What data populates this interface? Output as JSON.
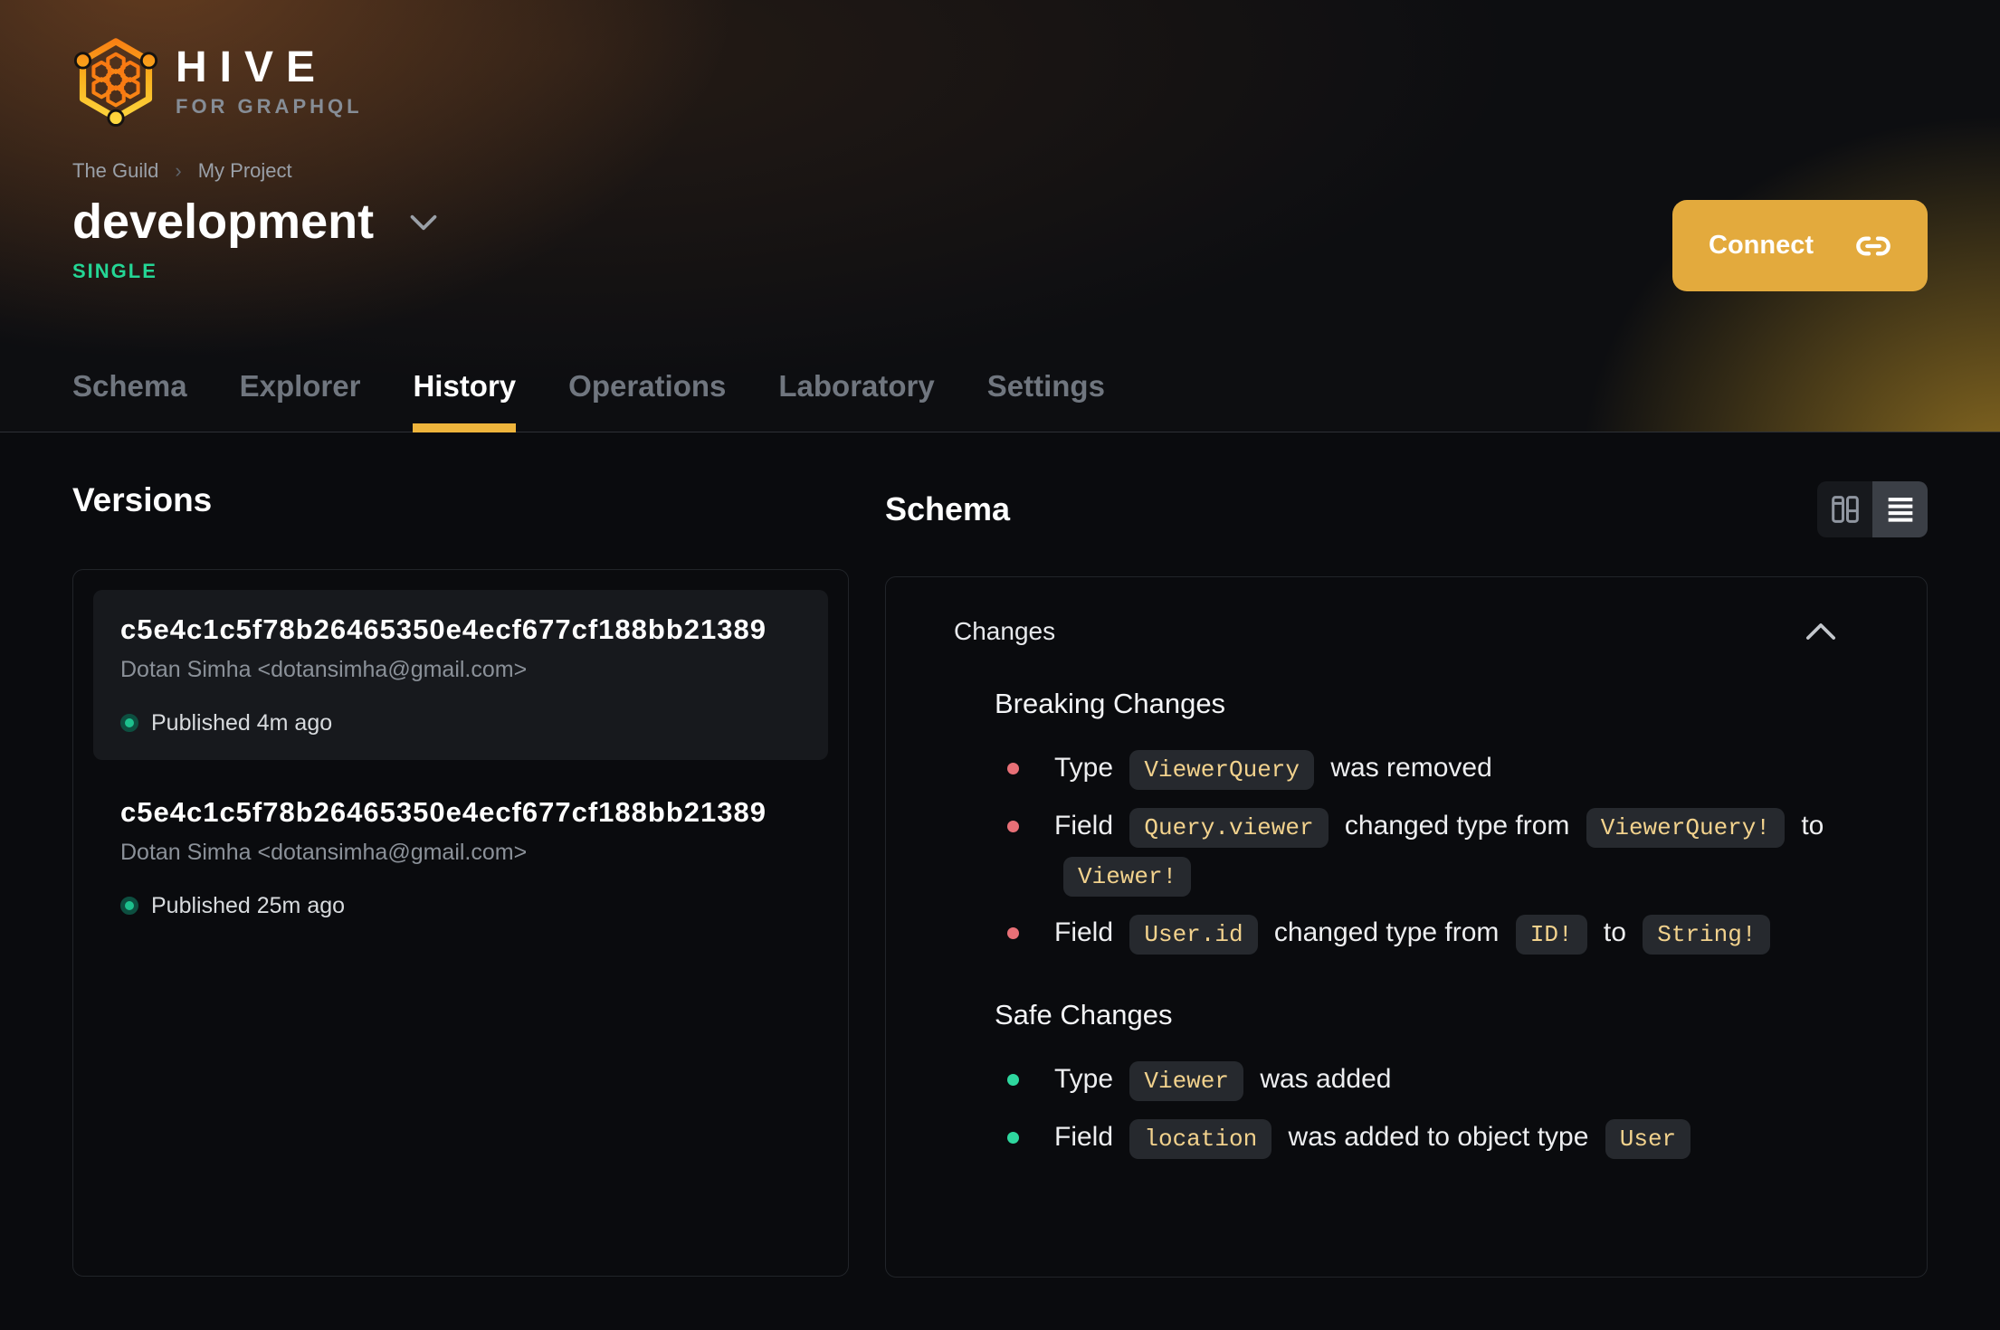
{
  "theme": {
    "accent_yellow": "#eeb43c",
    "connect_button_bg": "#e3aa3d",
    "single_badge_green": "#24d695",
    "danger_red": "#e87077",
    "success_green": "#2ed79e",
    "code_text_gold": "#f2d28d",
    "published_dot_green": "#1dc08d"
  },
  "brand": {
    "name": "HIVE",
    "tagline": "FOR GRAPHQL",
    "logo_icon": "hive-honeycomb-logo"
  },
  "breadcrumb": {
    "items": [
      "The Guild",
      "My Project"
    ],
    "separator": "›"
  },
  "project": {
    "title": "development",
    "badge": "SINGLE",
    "dropdown_icon": "chevron-down-icon"
  },
  "header_actions": {
    "connect_label": "Connect",
    "connect_icon": "link-icon"
  },
  "tabs": [
    {
      "label": "Schema",
      "active": false
    },
    {
      "label": "Explorer",
      "active": false
    },
    {
      "label": "History",
      "active": true
    },
    {
      "label": "Operations",
      "active": false
    },
    {
      "label": "Laboratory",
      "active": false
    },
    {
      "label": "Settings",
      "active": false
    }
  ],
  "versions": {
    "title": "Versions",
    "items": [
      {
        "hash": "c5e4c1c5f78b26465350e4ecf677cf188bb21389",
        "author": "Dotan Simha <dotansimha@gmail.com>",
        "status": "Published 4m ago",
        "selected": true
      },
      {
        "hash": "c5e4c1c5f78b26465350e4ecf677cf188bb21389",
        "author": "Dotan Simha <dotansimha@gmail.com>",
        "status": "Published 25m ago",
        "selected": false
      }
    ]
  },
  "schema_panel": {
    "title": "Schema",
    "view_toggle": {
      "options": [
        "columns-view-icon",
        "list-view-icon"
      ],
      "selected": "list-view-icon"
    },
    "changes": {
      "title": "Changes",
      "collapse_icon": "chevron-up-icon",
      "sections": [
        {
          "title": "Breaking Changes",
          "bullet_color": "#e87077",
          "items": [
            [
              {
                "text": "Type "
              },
              {
                "code": "ViewerQuery"
              },
              {
                "text": " was removed"
              }
            ],
            [
              {
                "text": "Field "
              },
              {
                "code": "Query.viewer"
              },
              {
                "text": " changed type from "
              },
              {
                "code": "ViewerQuery!"
              },
              {
                "text": " to "
              },
              {
                "code": "Viewer!"
              }
            ],
            [
              {
                "text": "Field "
              },
              {
                "code": "User.id"
              },
              {
                "text": " changed type from "
              },
              {
                "code": "ID!"
              },
              {
                "text": " to "
              },
              {
                "code": "String!"
              }
            ]
          ]
        },
        {
          "title": "Safe Changes",
          "bullet_color": "#2ed79e",
          "items": [
            [
              {
                "text": "Type "
              },
              {
                "code": "Viewer"
              },
              {
                "text": " was added"
              }
            ],
            [
              {
                "text": "Field "
              },
              {
                "code": "location"
              },
              {
                "text": " was added to object type "
              },
              {
                "code": "User"
              }
            ]
          ]
        }
      ]
    }
  }
}
